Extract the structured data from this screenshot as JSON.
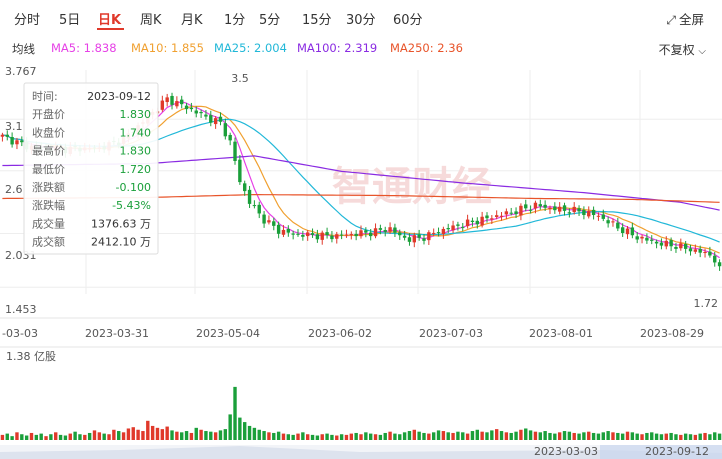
{
  "tabs": [
    {
      "label": "分时"
    },
    {
      "label": "5日"
    },
    {
      "label": "日K",
      "active": true
    },
    {
      "label": "周K"
    },
    {
      "label": "月K"
    },
    {
      "label": "1分"
    },
    {
      "label": "5分"
    },
    {
      "label": "15分"
    },
    {
      "label": "30分"
    },
    {
      "label": "60分"
    }
  ],
  "fullscreen_label": "全屏",
  "fullscreen_icon": "expand-icon",
  "fuquan_label": "不复权",
  "ma_label": "均线",
  "ma": [
    {
      "name": "MA5",
      "value": "1.838",
      "color": "#e641e6"
    },
    {
      "name": "MA10",
      "value": "1.855",
      "color": "#f0a030"
    },
    {
      "name": "MA25",
      "value": "2.004",
      "color": "#22b8d8"
    },
    {
      "name": "MA100",
      "value": "2.319",
      "color": "#8a2be2"
    },
    {
      "name": "MA250",
      "value": "2.36",
      "color": "#e8542a"
    }
  ],
  "tooltip": {
    "rows": [
      {
        "label": "时间:",
        "value": "2023-09-12",
        "color": "#333333"
      },
      {
        "label": "开盘价",
        "value": "1.830",
        "color": "#1a9f3a"
      },
      {
        "label": "收盘价",
        "value": "1.740",
        "color": "#1a9f3a"
      },
      {
        "label": "最高价",
        "value": "1.830",
        "color": "#1a9f3a"
      },
      {
        "label": "最低价",
        "value": "1.720",
        "color": "#1a9f3a"
      },
      {
        "label": "涨跌额",
        "value": "-0.100",
        "color": "#1a9f3a"
      },
      {
        "label": "涨跌幅",
        "value": "-5.43%",
        "color": "#1a9f3a"
      },
      {
        "label": "成交量",
        "value": "1376.63 万",
        "color": "#333333"
      },
      {
        "label": "成交额",
        "value": "2412.10 万",
        "color": "#333333"
      }
    ]
  },
  "watermark": "智通财经",
  "navigator": {
    "start": "2023-03-03",
    "end": "2023-09-12"
  },
  "chart_data": {
    "type": "candlestick",
    "y_ticks": [
      "3.767",
      "3.1",
      "2.6",
      "2.031",
      "1.453"
    ],
    "price_range": [
      1.453,
      3.767
    ],
    "annotations": [
      {
        "label": "3.5",
        "note": "period high"
      },
      {
        "label": "1.72",
        "note": "period low"
      }
    ],
    "x_tick_labels": [
      "-03-03",
      "2023-03-31",
      "2023-05-04",
      "2023-06-02",
      "2023-07-03",
      "2023-08-01",
      "2023-08-29"
    ],
    "volume_label": "1.38 亿股",
    "volume_max_label": "1.38 亿股",
    "colors": {
      "up": "#e0392b",
      "down": "#1a9f3a"
    },
    "anchor_closes": [
      [
        0,
        3.08
      ],
      [
        5,
        2.98
      ],
      [
        12,
        2.95
      ],
      [
        20,
        2.96
      ],
      [
        25,
        3.05
      ],
      [
        30,
        3.28
      ],
      [
        34,
        3.47
      ],
      [
        38,
        3.38
      ],
      [
        42,
        3.28
      ],
      [
        45,
        3.22
      ],
      [
        47,
        3.02
      ],
      [
        49,
        2.62
      ],
      [
        51,
        2.4
      ],
      [
        54,
        2.22
      ],
      [
        57,
        2.11
      ],
      [
        60,
        2.07
      ],
      [
        64,
        2.06
      ],
      [
        68,
        2.05
      ],
      [
        72,
        2.07
      ],
      [
        76,
        2.09
      ],
      [
        80,
        2.13
      ],
      [
        82,
        2.05
      ],
      [
        84,
        2.02
      ],
      [
        87,
        2.04
      ],
      [
        90,
        2.1
      ],
      [
        94,
        2.16
      ],
      [
        98,
        2.21
      ],
      [
        102,
        2.26
      ],
      [
        106,
        2.31
      ],
      [
        110,
        2.37
      ],
      [
        113,
        2.34
      ],
      [
        116,
        2.32
      ],
      [
        119,
        2.31
      ],
      [
        123,
        2.26
      ],
      [
        127,
        2.14
      ],
      [
        131,
        2.04
      ],
      [
        135,
        1.98
      ],
      [
        139,
        1.95
      ],
      [
        143,
        1.9
      ],
      [
        146,
        1.86
      ],
      [
        148,
        1.74
      ]
    ],
    "ma_lines": {
      "MA100": [
        [
          0,
          2.78
        ],
        [
          30,
          2.8
        ],
        [
          52,
          2.88
        ],
        [
          70,
          2.72
        ],
        [
          95,
          2.6
        ],
        [
          120,
          2.5
        ],
        [
          140,
          2.4
        ],
        [
          148,
          2.32
        ]
      ],
      "MA250": [
        [
          0,
          2.44
        ],
        [
          30,
          2.45
        ],
        [
          52,
          2.48
        ],
        [
          80,
          2.47
        ],
        [
          110,
          2.44
        ],
        [
          130,
          2.43
        ],
        [
          148,
          2.4
        ]
      ]
    },
    "volumes_rel": [
      0.08,
      0.1,
      0.06,
      0.12,
      0.09,
      0.07,
      0.11,
      0.08,
      0.1,
      0.06,
      0.09,
      0.12,
      0.08,
      0.07,
      0.1,
      0.13,
      0.09,
      0.08,
      0.11,
      0.15,
      0.12,
      0.1,
      0.09,
      0.16,
      0.14,
      0.12,
      0.18,
      0.2,
      0.16,
      0.14,
      0.3,
      0.22,
      0.19,
      0.17,
      0.21,
      0.15,
      0.13,
      0.12,
      0.14,
      0.11,
      0.19,
      0.16,
      0.14,
      0.13,
      0.12,
      0.15,
      0.17,
      0.4,
      0.83,
      0.35,
      0.28,
      0.22,
      0.19,
      0.16,
      0.14,
      0.12,
      0.11,
      0.13,
      0.1,
      0.09,
      0.08,
      0.1,
      0.12,
      0.09,
      0.08,
      0.07,
      0.09,
      0.1,
      0.08,
      0.07,
      0.09,
      0.08,
      0.1,
      0.11,
      0.09,
      0.12,
      0.1,
      0.09,
      0.08,
      0.11,
      0.13,
      0.1,
      0.09,
      0.12,
      0.14,
      0.16,
      0.13,
      0.11,
      0.1,
      0.12,
      0.15,
      0.14,
      0.12,
      0.11,
      0.13,
      0.12,
      0.1,
      0.14,
      0.16,
      0.13,
      0.12,
      0.15,
      0.17,
      0.14,
      0.12,
      0.11,
      0.13,
      0.16,
      0.18,
      0.15,
      0.13,
      0.12,
      0.14,
      0.11,
      0.1,
      0.12,
      0.14,
      0.13,
      0.11,
      0.1,
      0.12,
      0.13,
      0.11,
      0.1,
      0.12,
      0.14,
      0.12,
      0.11,
      0.1,
      0.13,
      0.12,
      0.1,
      0.09,
      0.11,
      0.12,
      0.1,
      0.09,
      0.1,
      0.11,
      0.09,
      0.08,
      0.1,
      0.09,
      0.08,
      0.1,
      0.11,
      0.09,
      0.12,
      0.1
    ]
  }
}
